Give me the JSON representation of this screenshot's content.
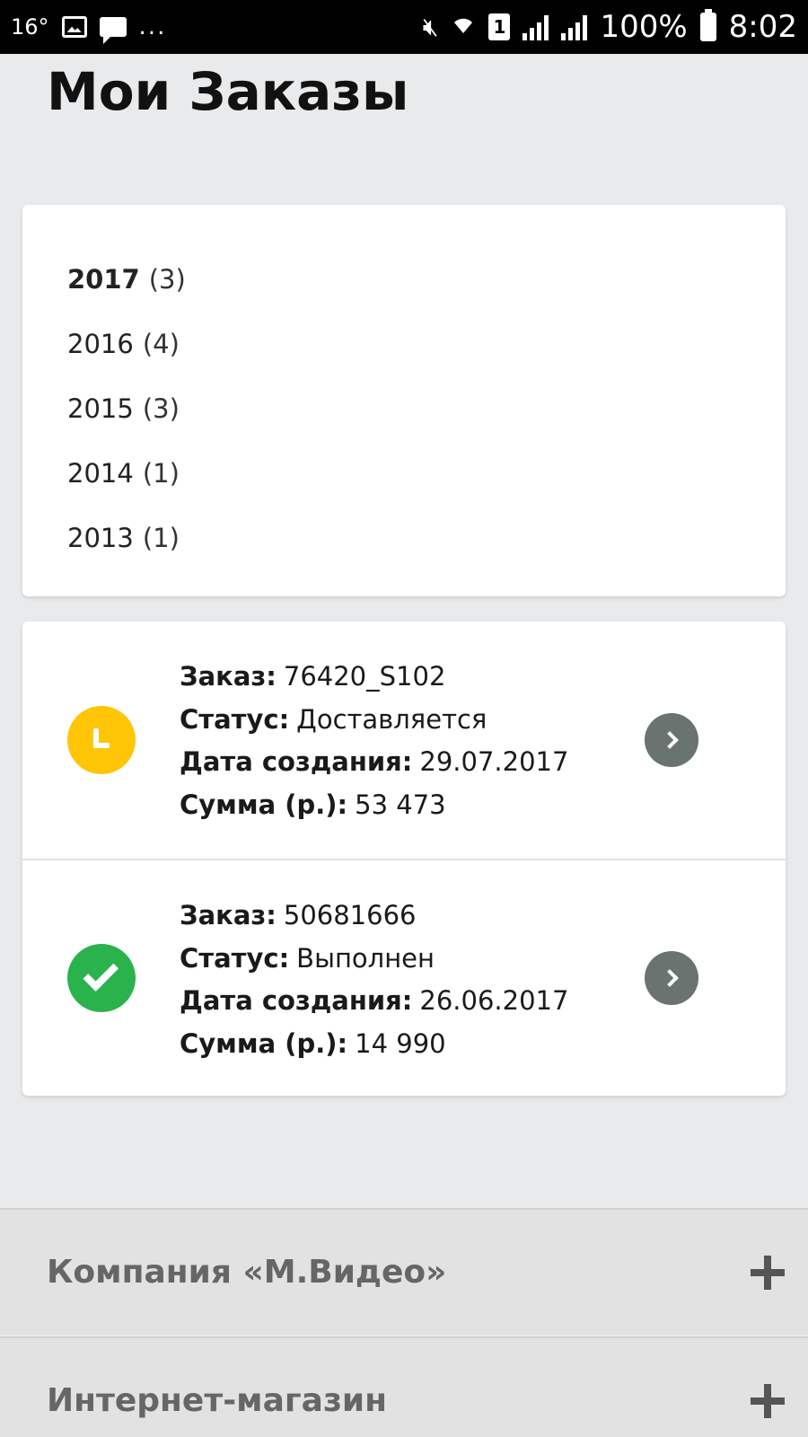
{
  "status_bar": {
    "temperature": "16°",
    "notifications_more": "...",
    "sim_slot": "1",
    "battery_percent": "100%",
    "time": "8:02",
    "icons": [
      "image-icon",
      "message-icon",
      "mute-icon",
      "wifi-icon",
      "sim-icon",
      "signal-icon",
      "battery-icon"
    ]
  },
  "page": {
    "title": "Мои Заказы"
  },
  "years": [
    {
      "year": "2017",
      "count": "(3)",
      "active": true
    },
    {
      "year": "2016",
      "count": "(4)",
      "active": false
    },
    {
      "year": "2015",
      "count": "(3)",
      "active": false
    },
    {
      "year": "2014",
      "count": "(1)",
      "active": false
    },
    {
      "year": "2013",
      "count": "(1)",
      "active": false
    }
  ],
  "orders": [
    {
      "status_icon": "clock-icon",
      "status_color": "#ffc506",
      "order_label": "Заказ:",
      "order_value": "76420_S102",
      "status_label": "Статус:",
      "status_value": "Доставляется",
      "date_label": "Дата создания:",
      "date_value": "29.07.2017",
      "sum_label": "Сумма (р.):",
      "sum_value": "53 473"
    },
    {
      "status_icon": "check-icon",
      "status_color": "#2ab24d",
      "order_label": "Заказ:",
      "order_value": "50681666",
      "status_label": "Статус:",
      "status_value": "Выполнен",
      "date_label": "Дата создания:",
      "date_value": "26.06.2017",
      "sum_label": "Сумма (р.):",
      "sum_value": "14 990"
    }
  ],
  "footer_accordion": [
    {
      "label": "Компания «М.Видео»",
      "icon": "plus-icon"
    },
    {
      "label": "Интернет-магазин",
      "icon": "plus-icon"
    }
  ]
}
